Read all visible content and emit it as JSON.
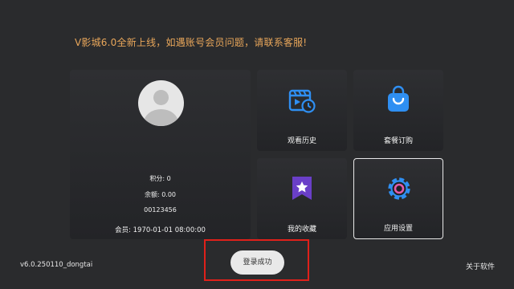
{
  "notice": {
    "text": "V影城6.0全新上线，如遇账号会员问题，请联系客服!"
  },
  "profile": {
    "points": "积分: 0",
    "balance": "余额: 0.00",
    "user_id": "00123456",
    "membership": "会员: 1970-01-01 08:00:00"
  },
  "tiles": [
    {
      "label": "观看历史",
      "icon": "history-icon"
    },
    {
      "label": "套餐订购",
      "icon": "shopping-bag-icon"
    },
    {
      "label": "我的收藏",
      "icon": "favorites-star-icon"
    },
    {
      "label": "应用设置",
      "icon": "settings-gear-icon"
    }
  ],
  "footer": {
    "version": "v6.0.250110_dongtai",
    "about": "关于软件"
  },
  "toast": {
    "text": "登录成功"
  },
  "colors": {
    "background": "#2a2b2d",
    "notice": "#e8a65a",
    "accent_blue": "#2f8ff2",
    "favorites_purple": "#6a3fc8",
    "settings_pink": "#e25aa8",
    "highlight_red": "#e0201a"
  }
}
